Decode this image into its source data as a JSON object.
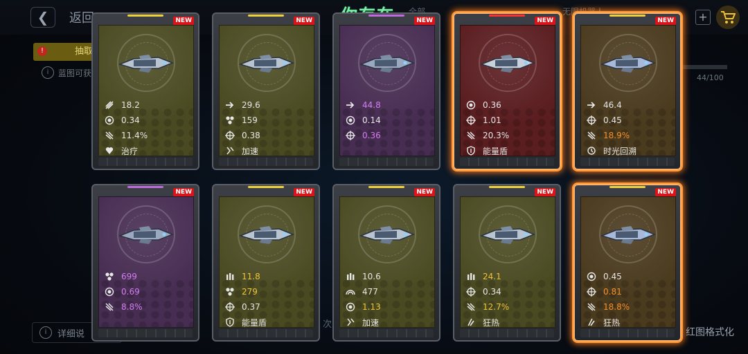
{
  "overlay_title": "你存在",
  "background": {
    "back_label": "返回",
    "tab_label": "抽取",
    "info_text": "蓝图可获",
    "progress_text": "44/100",
    "bottom_left_label": "详细说",
    "bottom_right_label": "红图格式化",
    "hint_text": "次",
    "top_dim_1": "全部",
    "top_dim_2": "无限机器人"
  },
  "cards": [
    {
      "rarity": "yellow",
      "glow": false,
      "new": "NEW",
      "topbar": "#f0d23a",
      "stats": [
        {
          "icon": "damage-icon",
          "value": "18.2",
          "color": "#e6e6e6"
        },
        {
          "icon": "cooldown-icon",
          "value": "0.34",
          "color": "#e6e6e6"
        },
        {
          "icon": "crit-icon",
          "value": "11.4%",
          "color": "#e6e6e6"
        },
        {
          "icon": "heal-icon",
          "value": "治疗",
          "color": "#e6e6e6"
        }
      ]
    },
    {
      "rarity": "yellow",
      "glow": false,
      "new": "NEW",
      "topbar": "#f0d23a",
      "stats": [
        {
          "icon": "speed-icon",
          "value": "29.6",
          "color": "#e6e6e6"
        },
        {
          "icon": "hull-icon",
          "value": "159",
          "color": "#e6e6e6"
        },
        {
          "icon": "accuracy-icon",
          "value": "0.38",
          "color": "#e6e6e6"
        },
        {
          "icon": "boost-icon",
          "value": "加速",
          "color": "#e6e6e6"
        }
      ]
    },
    {
      "rarity": "purple",
      "glow": false,
      "new": "NEW",
      "topbar": "#c06ae0",
      "stats": [
        {
          "icon": "speed-icon",
          "value": "44.8",
          "color": "#d27df0"
        },
        {
          "icon": "cooldown-icon",
          "value": "0.14",
          "color": "#e6e6e6"
        },
        {
          "icon": "accuracy-icon",
          "value": "0.36",
          "color": "#d27df0"
        }
      ]
    },
    {
      "rarity": "red",
      "glow": true,
      "new": "NEW",
      "topbar": "#ff3030",
      "stats": [
        {
          "icon": "cooldown-icon",
          "value": "0.36",
          "color": "#e6e6e6"
        },
        {
          "icon": "accuracy-icon",
          "value": "1.01",
          "color": "#e6e6e6"
        },
        {
          "icon": "crit-icon",
          "value": "20.3%",
          "color": "#e6e6e6"
        },
        {
          "icon": "shield-icon",
          "value": "能量盾",
          "color": "#e6e6e6"
        }
      ]
    },
    {
      "rarity": "bronze",
      "glow": true,
      "new": "NEW",
      "topbar": "#f0d23a",
      "stats": [
        {
          "icon": "speed-icon",
          "value": "46.4",
          "color": "#e6e6e6"
        },
        {
          "icon": "accuracy-icon",
          "value": "0.45",
          "color": "#e6e6e6"
        },
        {
          "icon": "crit-icon",
          "value": "18.9%",
          "color": "#f5902a"
        },
        {
          "icon": "rewind-icon",
          "value": "时光回溯",
          "color": "#e6e6e6"
        }
      ]
    },
    {
      "rarity": "purple",
      "glow": false,
      "new": "NEW",
      "topbar": "#c06ae0",
      "stats": [
        {
          "icon": "hull-icon",
          "value": "699",
          "color": "#d27df0"
        },
        {
          "icon": "cooldown-icon",
          "value": "0.69",
          "color": "#d27df0"
        },
        {
          "icon": "crit-icon",
          "value": "8.8%",
          "color": "#d27df0"
        }
      ]
    },
    {
      "rarity": "yellow",
      "glow": false,
      "new": "NEW",
      "topbar": "#f0d23a",
      "stats": [
        {
          "icon": "ammo-icon",
          "value": "11.8",
          "color": "#f0c43a"
        },
        {
          "icon": "hull-icon",
          "value": "279",
          "color": "#f0c43a"
        },
        {
          "icon": "accuracy-icon",
          "value": "0.37",
          "color": "#e6e6e6"
        },
        {
          "icon": "shield-icon",
          "value": "能量盾",
          "color": "#e6e6e6"
        }
      ]
    },
    {
      "rarity": "yellow",
      "glow": false,
      "new": "NEW",
      "topbar": "#f0d23a",
      "stats": [
        {
          "icon": "ammo-icon",
          "value": "10.6",
          "color": "#e6e6e6"
        },
        {
          "icon": "range-icon",
          "value": "477",
          "color": "#e6e6e6"
        },
        {
          "icon": "cooldown-icon",
          "value": "1.13",
          "color": "#f0c43a"
        },
        {
          "icon": "boost-icon",
          "value": "加速",
          "color": "#e6e6e6"
        }
      ]
    },
    {
      "rarity": "yellow",
      "glow": false,
      "new": "NEW",
      "topbar": "#f0d23a",
      "stats": [
        {
          "icon": "ammo-icon",
          "value": "24.1",
          "color": "#f0c43a"
        },
        {
          "icon": "accuracy-icon",
          "value": "0.34",
          "color": "#e6e6e6"
        },
        {
          "icon": "crit-icon",
          "value": "12.7%",
          "color": "#f0c43a"
        },
        {
          "icon": "berserk-icon",
          "value": "狂热",
          "color": "#e6e6e6"
        }
      ]
    },
    {
      "rarity": "bronze",
      "glow": true,
      "new": "NEW",
      "topbar": "#f0d23a",
      "stats": [
        {
          "icon": "cooldown-icon",
          "value": "0.45",
          "color": "#e6e6e6"
        },
        {
          "icon": "accuracy-icon",
          "value": "0.81",
          "color": "#f5902a"
        },
        {
          "icon": "crit-icon",
          "value": "18.8%",
          "color": "#f5902a"
        },
        {
          "icon": "berserk-icon",
          "value": "狂热",
          "color": "#e6e6e6"
        }
      ]
    }
  ]
}
